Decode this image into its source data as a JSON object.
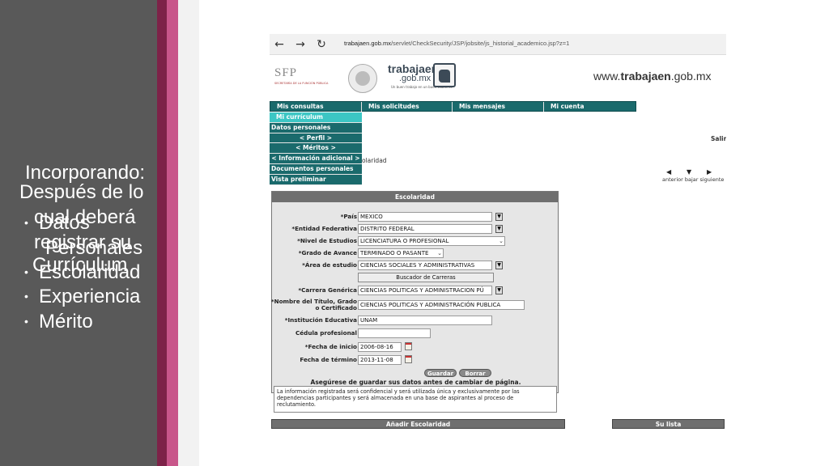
{
  "slide": {
    "title_lines": [
      "Incorporando:",
      "Después de lo",
      "cual deberá",
      "registrar su",
      "Currículum"
    ],
    "bullets": [
      "Datos",
      "Personales",
      "Escolaridad",
      "Experiencia",
      "Mérito"
    ],
    "colors": {
      "left_panel": "#595959",
      "stripe_dark": "#7d2248",
      "stripe_pink": "#c8568a"
    }
  },
  "browser": {
    "url_host": "trabajaen.gob.mx",
    "url_path": "/servlet/CheckSecurity/JSP/jobsite/js_historial_academico.jsp?z=1",
    "icons": {
      "back": "arrow-left-icon",
      "forward": "arrow-right-icon",
      "reload": "reload-icon"
    }
  },
  "site": {
    "sfp_logo": "SFP",
    "sfp_sub": "SECRETARÍA DE LA FUNCIÓN PÚBLICA",
    "brand_name": "trabajaen",
    "brand_domain": ".gob.mx",
    "brand_slogan": "Un buen trabajo en un buen Gobierno",
    "url_prefix": "www.",
    "url_bold": "trabajaen",
    "url_suffix": ".gob.mx",
    "accent": "#1a6a6c"
  },
  "top_menu": [
    "Mis consultas",
    "Mis solicitudes",
    "Mis mensajes",
    "Mi cuenta"
  ],
  "side_menu": [
    "Mi currículum",
    "Datos personales",
    "< Perfil >",
    "< Méritos >",
    "< Información adicional >",
    "Documentos personales",
    "Vista preliminar"
  ],
  "salir": "Salir",
  "breadcrumb_fragment": "olaridad",
  "pager": {
    "labels": "anterior bajar siguiente"
  },
  "form": {
    "title": "Escolaridad",
    "fields": [
      {
        "label": "*País",
        "value": "MEXICO"
      },
      {
        "label": "*Entidad Federativa",
        "value": "DISTRITO FEDERAL"
      },
      {
        "label": "*Nivel de Estudios",
        "value": "LICENCIATURA O PROFESIONAL"
      },
      {
        "label": "*Grado de Avance",
        "value": "TERMINADO O PASANTE"
      },
      {
        "label": "*Área de estudio",
        "value": "CIENCIAS SOCIALES Y ADMINISTRATIVAS"
      },
      {
        "label": "*Carrera Genérica",
        "value": "CIENCIAS POLITICAS Y ADMINISTRACION PÚ"
      },
      {
        "label": "*Nombre del Título, Grado",
        "label2": "o Certificado",
        "value": "CIENCIAS POLITICAS Y ADMINISTRACIÓN PUBLICA"
      },
      {
        "label": "*Institución Educativa",
        "value": "UNAM"
      },
      {
        "label": "Cédula profesional",
        "value": ""
      },
      {
        "label": "*Fecha de inicio",
        "value": "2006-08-16"
      },
      {
        "label": "Fecha de término",
        "value": "2013-11-08"
      }
    ],
    "search_button": "Buscador de Carreras",
    "save_button": "Guardar",
    "clear_button": "Borrar",
    "save_note": "Asegúrese de guardar sus datos antes de cambiar de página.",
    "privacy_note": "La información registrada será confidencial y será utilizada única y exclusivamente por las dependencias participantes y será almacenada en una base de aspirantes al proceso de reclutamiento."
  },
  "bottom": {
    "left": "Añadir Escolaridad",
    "right": "Su lista"
  }
}
